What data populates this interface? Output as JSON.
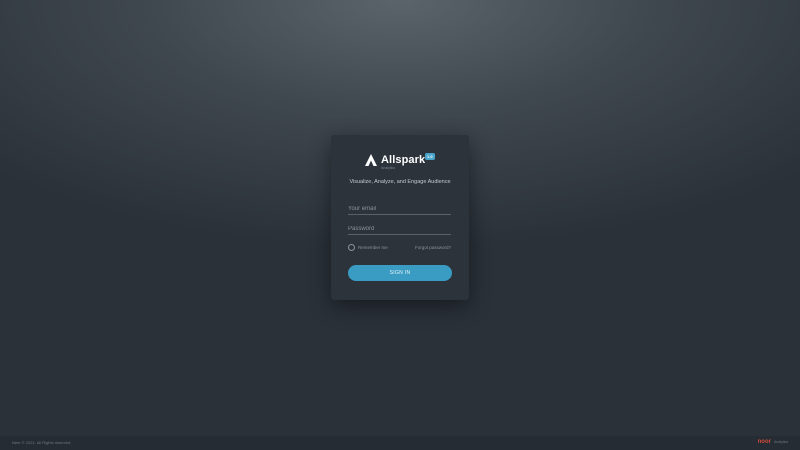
{
  "login": {
    "brand": "Allspark",
    "version": "1.0",
    "sub_brand": "Analytics",
    "tagline": "Visualize, Analyze, and Engage Audience",
    "email_placeholder": "Your email",
    "password_placeholder": "Password",
    "remember_label": "Remember me",
    "forgot_label": "Forgot password?",
    "signin_label": "SIGN IN"
  },
  "footer": {
    "copyright": "Neer © 2021. All Rights reserved.",
    "brand": "noor",
    "brand_tagline": "Analytics"
  },
  "icons": {
    "logo": "allspark-logo-icon"
  },
  "colors": {
    "accent": "#3a9cc3",
    "card_bg": "#2c333b",
    "footer_brand": "#d04a3a"
  }
}
